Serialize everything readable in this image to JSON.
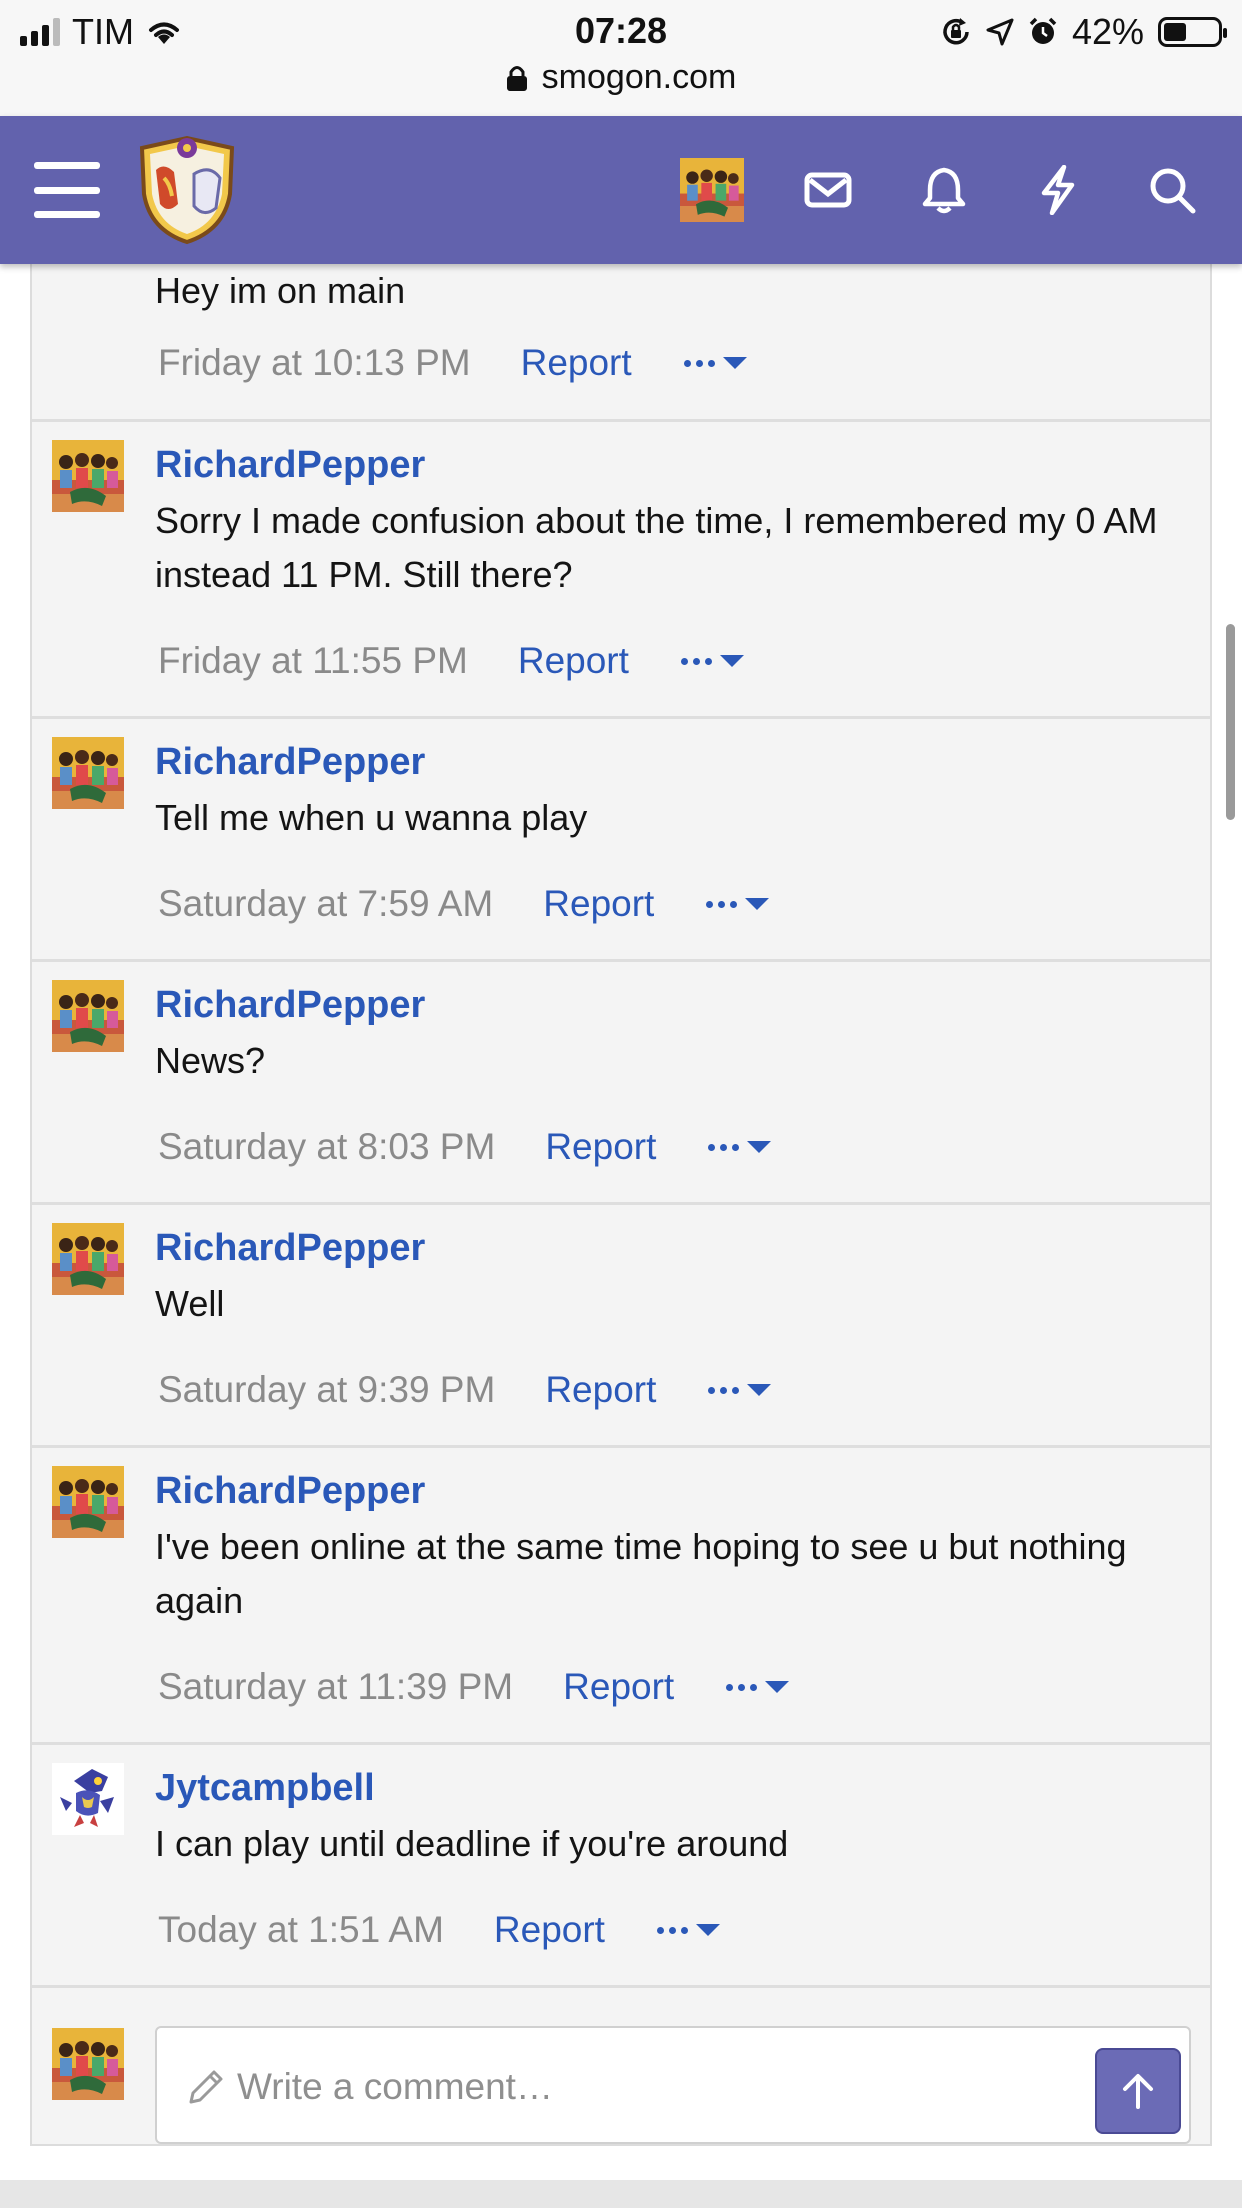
{
  "status_bar": {
    "carrier": "TIM",
    "time": "07:28",
    "battery": "42%",
    "battery_level": 0.42,
    "url": "smogon.com"
  },
  "header": {
    "icons": [
      "menu-icon",
      "site-logo",
      "user-avatar",
      "inbox-icon",
      "bell-icon",
      "lightning-icon",
      "search-icon"
    ]
  },
  "messages": [
    {
      "author": "",
      "text": "Hey im on main",
      "time": "Friday at 10:13 PM",
      "report": "Report"
    },
    {
      "author": "RichardPepper",
      "text": "Sorry I made confusion about the time, I remembered my 0 AM instead 11 PM. Still there?",
      "time": "Friday at 11:55 PM",
      "report": "Report"
    },
    {
      "author": "RichardPepper",
      "text": "Tell me when u wanna play",
      "time": "Saturday at 7:59 AM",
      "report": "Report"
    },
    {
      "author": "RichardPepper",
      "text": "News?",
      "time": "Saturday at 8:03 PM",
      "report": "Report"
    },
    {
      "author": "RichardPepper",
      "text": "Well",
      "time": "Saturday at 9:39 PM",
      "report": "Report"
    },
    {
      "author": "RichardPepper",
      "text": "I've been online at the same time hoping to see u but nothing again",
      "time": "Saturday at 11:39 PM",
      "report": "Report"
    },
    {
      "author": "Jytcampbell",
      "text": "I can play until deadline if you're around",
      "time": "Today at 1:51 AM",
      "report": "Report"
    }
  ],
  "composer": {
    "placeholder": "Write a comment…"
  }
}
